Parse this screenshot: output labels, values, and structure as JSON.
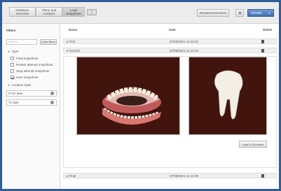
{
  "tabs": [
    {
      "label": "Database Overview"
    },
    {
      "label": "Plane and Analysis"
    },
    {
      "label": "Load Snapshots"
    }
  ],
  "toolbar": {
    "restart_label": "Restart/reset/check",
    "results_label": "Results",
    "tool_icon": "camera-icon",
    "close_icon": "close-icon"
  },
  "sidebar": {
    "title": "Filters",
    "search_placeholder": "Search...",
    "clear_label": "Clear filters",
    "type_label": "Type",
    "types": [
      {
        "label": "Final snapshots",
        "checked": false
      },
      {
        "label": "Restart attempt snapshots",
        "checked": false
      },
      {
        "label": "Stop attempt snapshots",
        "checked": false
      },
      {
        "label": "User snapshots",
        "checked": true
      }
    ],
    "creation_date_label": "Creation Date",
    "from_date": "From date",
    "to_date": "To date"
  },
  "table": {
    "headers": {
      "name": "Name",
      "date": "Date",
      "delete": "Delete"
    },
    "rows": [
      {
        "name": "First",
        "date": "07/08/2021 11:10:40",
        "expanded": false
      },
      {
        "name": "Second",
        "date": "07/08/2021 11:13:33",
        "expanded": true
      },
      {
        "name": "Final",
        "date": "07/08/2021 11:14:09",
        "expanded": false
      }
    ],
    "load_button": "Load in Simulator"
  },
  "colors": {
    "frame": "#2f5d9a",
    "image_bg": "#42140e",
    "accent": "#3f6fb4"
  }
}
